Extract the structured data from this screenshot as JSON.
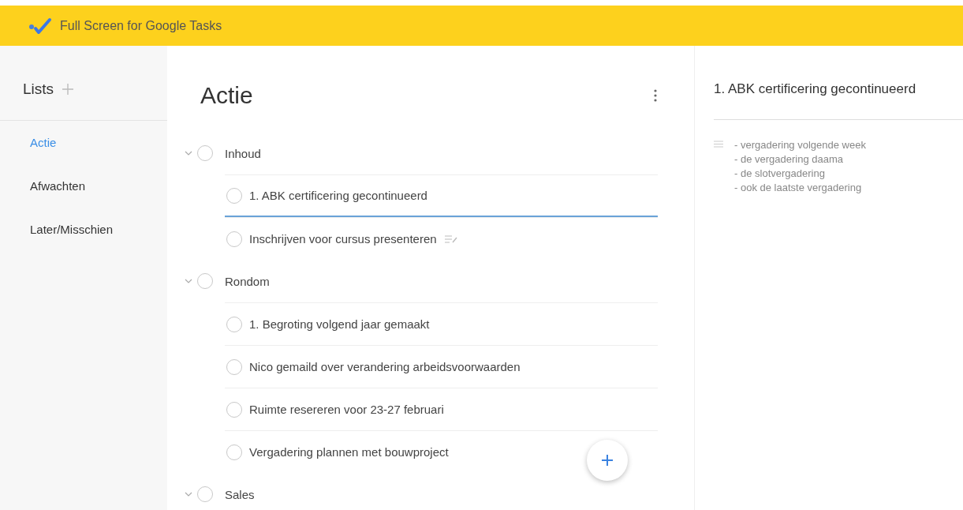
{
  "app_bar": {
    "title": "Full Screen for Google Tasks"
  },
  "sidebar": {
    "heading": "Lists",
    "items": [
      {
        "label": "Actie",
        "selected": true
      },
      {
        "label": "Afwachten",
        "selected": false
      },
      {
        "label": "Later/Misschien",
        "selected": false
      }
    ]
  },
  "list": {
    "title": "Actie",
    "groups": [
      {
        "title": "Inhoud",
        "expanded": true,
        "completed": false,
        "children": [
          {
            "title": "1. ABK certificering gecontinueerd",
            "completed": false,
            "selected": true,
            "has_notes": false
          },
          {
            "title": "Inschrijven voor cursus presenteren",
            "completed": false,
            "selected": false,
            "has_notes": true
          }
        ]
      },
      {
        "title": "Rondom",
        "expanded": true,
        "completed": false,
        "children": [
          {
            "title": "1. Begroting volgend jaar gemaakt",
            "completed": false,
            "selected": false,
            "has_notes": false
          },
          {
            "title": "Nico gemaild over verandering arbeidsvoorwaarden",
            "completed": false,
            "selected": false,
            "has_notes": false
          },
          {
            "title": "Ruimte resereren voor 23-27 februari",
            "completed": false,
            "selected": false,
            "has_notes": false
          },
          {
            "title": "Vergadering plannen met bouwproject",
            "completed": false,
            "selected": false,
            "has_notes": false
          }
        ]
      },
      {
        "title": "Sales",
        "expanded": true,
        "completed": false
      }
    ]
  },
  "detail": {
    "title": "1. ABK certificering gecontinueerd",
    "notes": "- vergadering volgende week\n- de vergadering daama\n- de slotvergadering\n- ook de laatste vergadering"
  }
}
